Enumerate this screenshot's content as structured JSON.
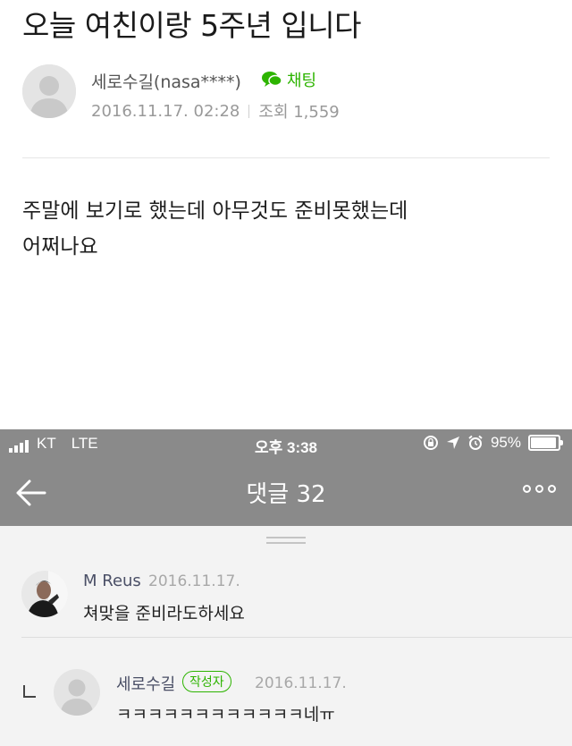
{
  "post": {
    "title": "오늘 여친이랑 5주년 입니다",
    "author": "세로수길(nasa****)",
    "chat_label": "채팅",
    "date": "2016.11.17. 02:28",
    "views": "조회 1,559",
    "body_lines": [
      "주말에 보기로 했는데 아무것도 준비못했는데",
      "어쩌나요"
    ]
  },
  "status_bar": {
    "carrier": "KT",
    "network": "LTE",
    "time": "오후 3:38",
    "battery_percent": "95%",
    "battery_level": 0.95,
    "icons": [
      "signal-icon",
      "rotation-lock-icon",
      "location-arrow-icon",
      "alarm-icon",
      "battery-icon"
    ]
  },
  "nav": {
    "title": "댓글 32",
    "back_icon": "back-arrow-icon",
    "more_icon": "more-dots-icon"
  },
  "comments": [
    {
      "author": "M Reus",
      "date": "2016.11.17.",
      "text": "쳐맞을 준비라도하세요",
      "is_reply": false
    },
    {
      "author": "세로수길",
      "badge": "작성자",
      "date": "2016.11.17.",
      "text": "ㅋㅋㅋㅋㅋㅋㅋㅋㅋㅋㅋㅋ네ㅠ",
      "is_reply": true
    }
  ],
  "colors": {
    "accent_green": "#2db400",
    "header_gray": "#8a8a8a",
    "comment_bg": "#f3f3f3"
  }
}
